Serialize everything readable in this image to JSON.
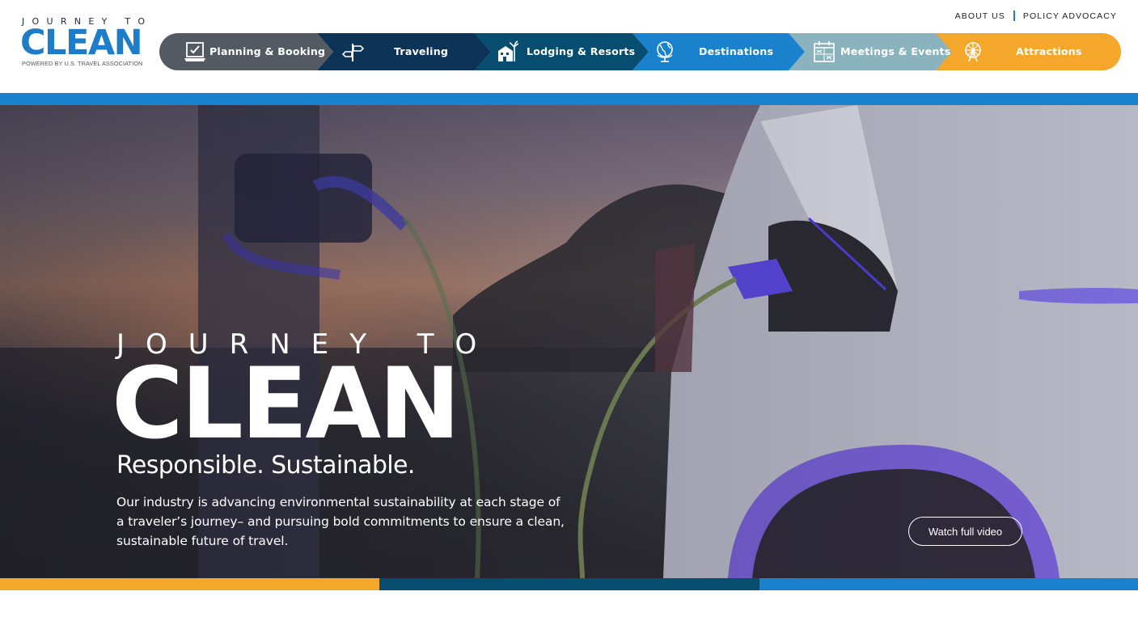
{
  "logo": {
    "top": "JOURNEY TO",
    "main": "CLEAN",
    "sub": "POWERED BY U.S. TRAVEL ASSOCIATION"
  },
  "utility_nav": {
    "about": "ABOUT US",
    "policy": "POLICY ADVOCACY"
  },
  "nav": {
    "items": [
      {
        "label": "Planning & Booking",
        "icon": "laptop-check-icon",
        "color": "#545a61"
      },
      {
        "label": "Traveling",
        "icon": "signpost-icon",
        "color": "#0d3356"
      },
      {
        "label": "Lodging & Resorts",
        "icon": "hotel-icon",
        "color": "#064d6f"
      },
      {
        "label": "Destinations",
        "icon": "globe-icon",
        "color": "#1a82cc"
      },
      {
        "label": "Meetings & Events",
        "icon": "calendar-icon",
        "color": "#8ab3bd"
      },
      {
        "label": "Attractions",
        "icon": "ferris-wheel-icon",
        "color": "#f4a72a"
      }
    ]
  },
  "hero": {
    "title_top": "JOURNEY TO",
    "title_main": "CLEAN",
    "tagline": "Responsible. Sustainable.",
    "body": "Our industry is advancing environmental sustainability at each stage of a traveler’s journey– and pursuing bold commitments to ensure a clean, sustainable future of travel.",
    "button": "Watch full video"
  },
  "colors": {
    "brand_blue": "#1a82cc",
    "orange": "#f4a72a",
    "teal_dark": "#064d6f"
  }
}
